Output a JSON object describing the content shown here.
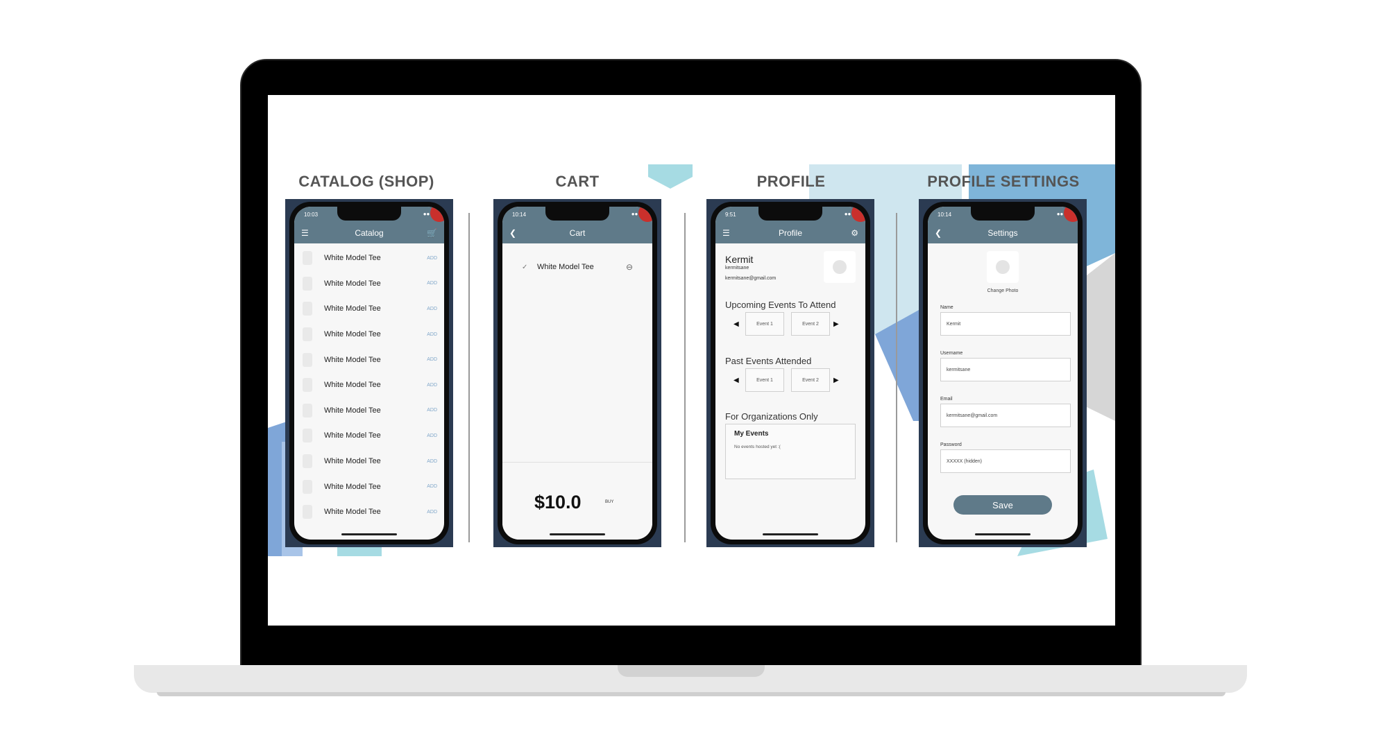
{
  "colors": {
    "accent": "#5f7a89",
    "decor_blue": "#7fa6d8",
    "decor_light": "#cfe6ef",
    "decor_cyan": "#a6dbe3",
    "decor_gray": "#d6d6d6",
    "phone_frame": "#2b3b52"
  },
  "sections": {
    "catalog": "CATALOG (SHOP)",
    "cart": "CART",
    "profile": "PROFILE",
    "settings": "PROFILE SETTINGS"
  },
  "catalog": {
    "time": "10:03",
    "title": "Catalog",
    "menu_icon": "menu-icon",
    "cart_icon": "cart-icon",
    "items": [
      {
        "name": "White Model Tee",
        "action": "ADD"
      },
      {
        "name": "White Model Tee",
        "action": "ADD"
      },
      {
        "name": "White Model Tee",
        "action": "ADD"
      },
      {
        "name": "White Model Tee",
        "action": "ADD"
      },
      {
        "name": "White Model Tee",
        "action": "ADD"
      },
      {
        "name": "White Model Tee",
        "action": "ADD"
      },
      {
        "name": "White Model Tee",
        "action": "ADD"
      },
      {
        "name": "White Model Tee",
        "action": "ADD"
      },
      {
        "name": "White Model Tee",
        "action": "ADD"
      },
      {
        "name": "White Model Tee",
        "action": "ADD"
      },
      {
        "name": "White Model Tee",
        "action": "ADD"
      }
    ]
  },
  "cart": {
    "time": "10:14",
    "title": "Cart",
    "item": "White Model Tee",
    "total": "$10.0",
    "buy": "BUY"
  },
  "profile": {
    "time": "9:51",
    "title": "Profile",
    "name": "Kermit",
    "username": "kermitsane",
    "email": "kermitsane@gmail.com",
    "upcoming_heading": "Upcoming Events To Attend",
    "upcoming_events": [
      "Event 1",
      "Event 2"
    ],
    "past_heading": "Past Events Attended",
    "past_events": [
      "Event 1",
      "Event 2"
    ],
    "org_heading": "For Organizations Only",
    "org_box_title": "My Events",
    "org_box_empty": "No events hosted yet :("
  },
  "settings": {
    "time": "10:14",
    "title": "Settings",
    "change_photo": "Change Photo",
    "name_label": "Name",
    "name_value": "Kermit",
    "username_label": "Username",
    "username_value": "kermitsane",
    "email_label": "Email",
    "email_value": "kermitsane@gmail.com",
    "password_label": "Password",
    "password_value": "XXXXX (hidden)",
    "save": "Save"
  }
}
